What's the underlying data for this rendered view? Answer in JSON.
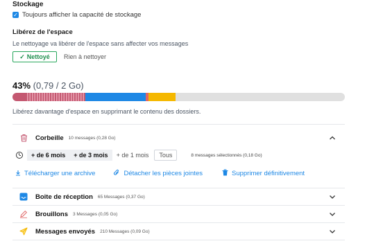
{
  "storage": {
    "heading": "Stockage",
    "show_capacity_label": "Toujours afficher la capacité de stockage",
    "show_capacity_checked": true
  },
  "cleanup": {
    "heading": "Libérez de l'espace",
    "description": "Le nettoyage va libérer de l'espace sans affecter vos messages",
    "cleaned_button": "Nettoyé",
    "nothing_label": "Rien à nettoyer"
  },
  "usage": {
    "percent_text": "43%",
    "detail_text": "(0,79 / 2 Go)",
    "percent": 43,
    "segments": [
      {
        "name": "trash",
        "fraction": 0.04,
        "color": "#c45871"
      },
      {
        "name": "trash-selected",
        "fraction": 0.18,
        "color": "#c45871",
        "striped": true
      },
      {
        "name": "inbox",
        "fraction": 0.18,
        "color": "#1e88e5"
      },
      {
        "name": "drafts",
        "fraction": 0.01,
        "color": "#e06666"
      },
      {
        "name": "sent",
        "fraction": 0.08,
        "color": "#f5b800"
      }
    ],
    "track_color": "#e0e0e0",
    "free_space_text": "Libérez davantage d'espace en supprimant le contenu des dossiers."
  },
  "folders": {
    "trash": {
      "name": "Corbeille",
      "info": "10 messages (0,28 Go)",
      "icon": "trash-icon",
      "expanded": true
    },
    "inbox": {
      "name": "Boite de réception",
      "info": "65 Messages (0,37 Go)",
      "icon": "inbox-icon",
      "expanded": false
    },
    "drafts": {
      "name": "Brouillons",
      "info": "3 Messages (0,05 Go)",
      "icon": "pencil-icon",
      "expanded": false
    },
    "sent": {
      "name": "Messages envoyés",
      "info": "210 Messages (0,09 Go)",
      "icon": "send-icon",
      "expanded": false
    }
  },
  "filters": {
    "chips": [
      "+ de 6 mois",
      "+ de 3 mois",
      "+ de 1 mois",
      "Tous"
    ],
    "selected_count": "8 messages sélectionnés (0,18 Go)"
  },
  "actions": {
    "download": "Télécharger une archive",
    "detach": "Détacher les pièces jointes",
    "delete": "Supprimer définitivement"
  },
  "colors": {
    "accent": "#1e88e5",
    "success": "#26a65b",
    "trash": "#c45871",
    "drafts": "#e06666",
    "sent": "#f5b800"
  }
}
